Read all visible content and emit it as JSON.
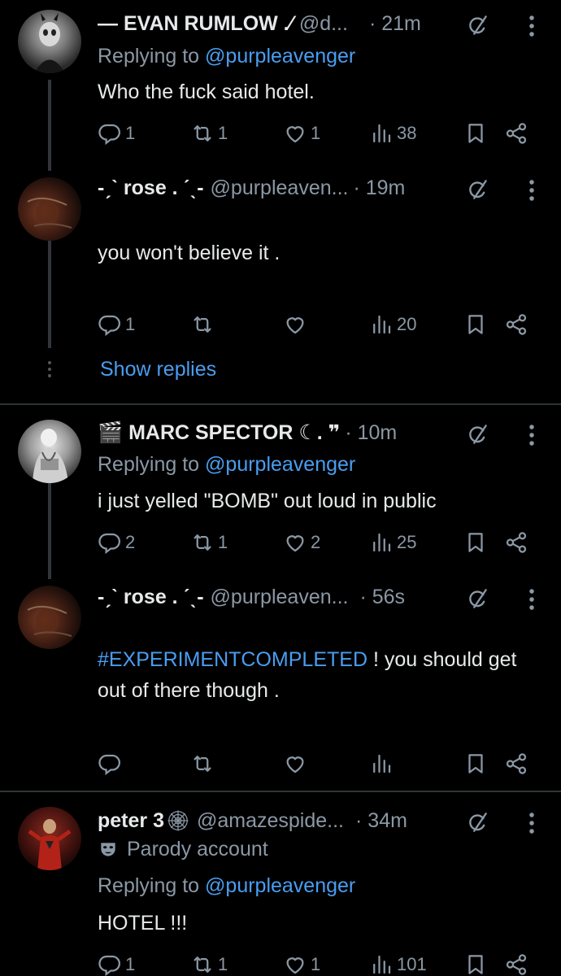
{
  "tweets": [
    {
      "name": "— EVAN RUMLOW .⁄",
      "handle": "@d...",
      "time": "· 21m",
      "replying_prefix": "Replying to ",
      "replying_handle": "@purpleavenger",
      "text": "Who the fuck said hotel.",
      "replies": "1",
      "reposts": "1",
      "likes": "1",
      "views": "38"
    },
    {
      "name": "-ˏˋ rose . ˊˎ-",
      "handle": "@purpleaven...",
      "time": "· 19m",
      "text": "you won't believe it .",
      "replies": "1",
      "reposts": "",
      "likes": "",
      "views": "20",
      "show_replies": "Show replies"
    },
    {
      "name": "🎬 MARC SPECTOR ☾. ❞",
      "handle": "",
      "time": "· 10m",
      "replying_prefix": "Replying to ",
      "replying_handle": "@purpleavenger",
      "text": "i just yelled \"BOMB\" out loud in public",
      "replies": "2",
      "reposts": "1",
      "likes": "2",
      "views": "25"
    },
    {
      "name": "-ˏˋ rose . ˊˎ-",
      "handle": "@purpleaven...",
      "time": "· 56s",
      "hashtag": "#EXPERIMENTCOMPLETED",
      "text_rest": " ! you should get out of there though .",
      "replies": "",
      "reposts": "",
      "likes": "",
      "views": ""
    },
    {
      "name": "peter 3",
      "name_icon": "spider-web-icon",
      "handle": "@amazespide...",
      "time": "· 34m",
      "parody": "Parody account",
      "replying_prefix": "Replying to ",
      "replying_handle": "@purpleavenger",
      "text": "HOTEL !!!",
      "replies": "1",
      "reposts": "1",
      "likes": "1",
      "views": "101"
    }
  ],
  "colors": {
    "background": "#000000",
    "text": "#e7e9ea",
    "muted": "#8b98a5",
    "link": "#4a9df0",
    "divider": "#2f3336"
  }
}
